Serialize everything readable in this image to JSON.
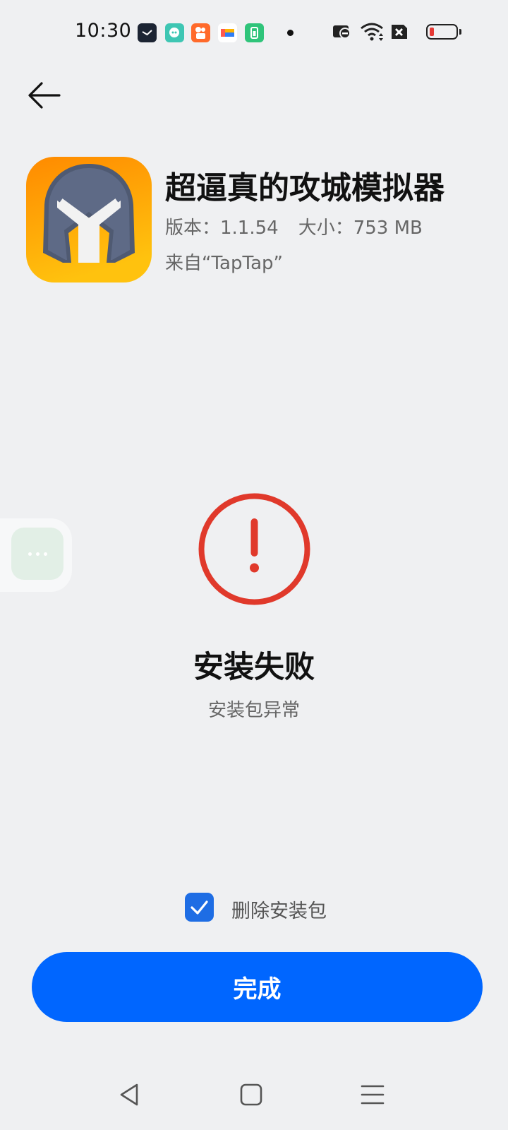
{
  "status_bar": {
    "time": "10:30",
    "icons": [
      "clock-app-icon",
      "chat-app-icon",
      "kuaishou-app-icon",
      "wallet-app-icon",
      "battery-saver-app-icon"
    ],
    "right_icons": [
      "camera-block-icon",
      "wifi-icon",
      "sim-error-icon",
      "battery-low-icon"
    ],
    "battery_color": "#e53935"
  },
  "header": {
    "back_icon": "back-arrow-icon"
  },
  "app": {
    "name": "超逼真的攻城模拟器",
    "version_label": "版本：1.1.54",
    "size_label": "大小：753 MB",
    "source_label": "来自“TapTap”",
    "icon": "spartan-helmet-app-icon"
  },
  "result": {
    "icon": "error-exclamation-icon",
    "title": "安装失败",
    "subtitle": "安装包异常",
    "accent_color": "#e0392b"
  },
  "options": {
    "delete_package_label": "删除安装包",
    "delete_package_checked": true
  },
  "actions": {
    "done_label": "完成",
    "primary_color": "#0066ff"
  },
  "nav_bar": {
    "items": [
      "back-nav-icon",
      "home-nav-icon",
      "menu-nav-icon"
    ]
  }
}
